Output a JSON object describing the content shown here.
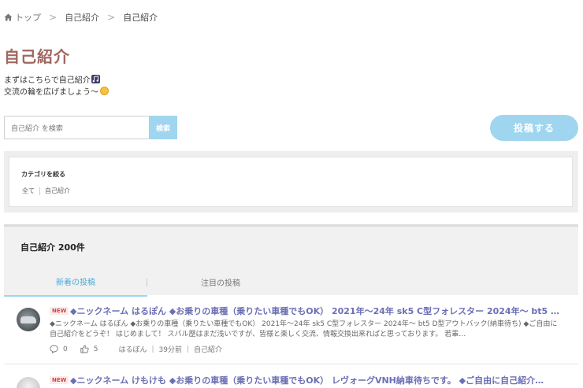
{
  "breadcrumb": {
    "home": "トップ",
    "level1": "自己紹介",
    "current": "自己紹介"
  },
  "page": {
    "title": "自己紹介",
    "intro_line1": "まずはこちらで自己紹介",
    "intro_line2": "交流の輪を広げましょう〜"
  },
  "search": {
    "placeholder": "自己紹介 を検索",
    "button": "検索"
  },
  "post_button": "投稿する",
  "category": {
    "heading": "カテゴリを絞る",
    "options": [
      "全て",
      "自己紹介"
    ]
  },
  "list": {
    "count_label": "自己紹介 200件",
    "tabs": [
      "新着の投稿",
      "注目の投稿"
    ],
    "active_tab": "新着の投稿"
  },
  "posts": [
    {
      "badge": "NEW",
      "title": "◆ニックネーム はるぽん ◆お乗りの車種（乗りたい車種でもOK） 2021年〜24年 sk5 C型フォレスター 2024年〜 bt5 D…",
      "body": "◆ニックネーム はるぽん ◆お乗りの車種（乗りたい車種でもOK） 2021年〜24年 sk5 C型フォレスター 2024年〜 bt5 D型アウトバック(納車待ち) ◆ご自由に自己紹介をどうぞ！ はじめまして！ スバル歴はまだ浅いですが、皆様と楽しく交流、情報交換出来ればと思っております。 若輩…",
      "comments": "0",
      "likes": "5",
      "author": "はるぽん",
      "time": "39分前",
      "category": "自己紹介"
    },
    {
      "badge": "NEW",
      "title": "◆ニックネーム けもけも ◆お乗りの車種（乗りたい車種でもOK） レヴォーグVNH納車待ちです。 ◆ご自由に自己紹介…"
    }
  ],
  "colors": {
    "accent": "#9fd5ef",
    "title": "#a06760",
    "post_title": "#6b6fb4",
    "badge": "#d64545"
  }
}
